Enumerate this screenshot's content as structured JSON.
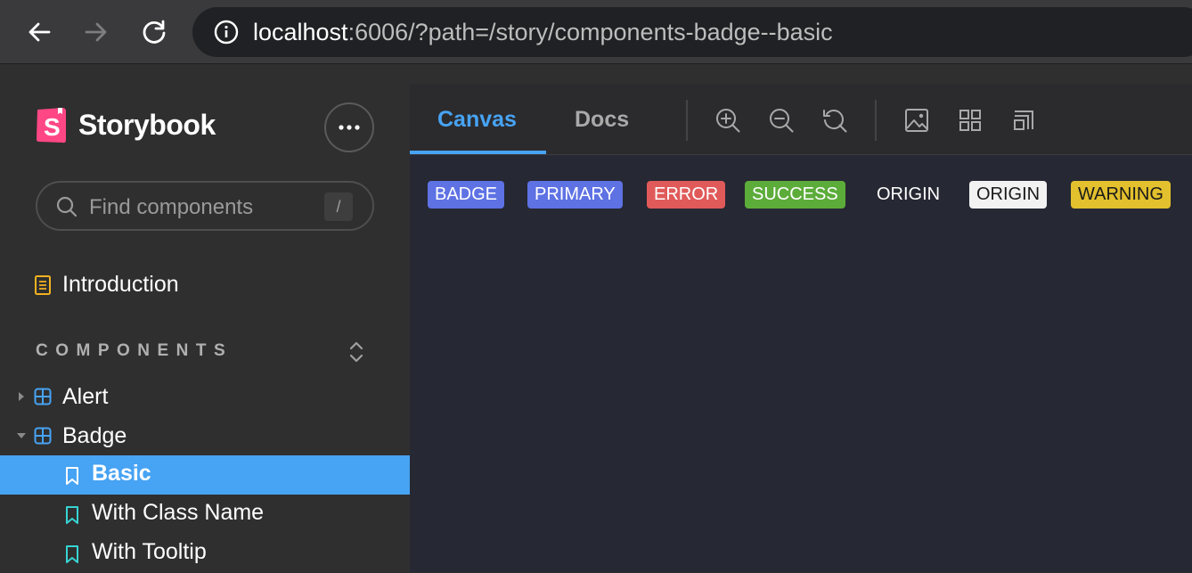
{
  "browser": {
    "url_host": "localhost",
    "url_rest": ":6006/?path=/story/components-badge--basic"
  },
  "sidebar": {
    "brand": "Storybook",
    "search_placeholder": "Find components",
    "search_shortcut": "/",
    "intro_label": "Introduction",
    "section_title": "COMPONENTS",
    "tree": [
      {
        "label": "Alert",
        "expanded": false
      },
      {
        "label": "Badge",
        "expanded": true
      }
    ],
    "stories": [
      {
        "label": "Basic",
        "active": true
      },
      {
        "label": "With Class Name",
        "active": false
      },
      {
        "label": "With Tooltip",
        "active": false
      }
    ]
  },
  "toolbar": {
    "tabs": [
      {
        "label": "Canvas",
        "active": true
      },
      {
        "label": "Docs",
        "active": false
      }
    ],
    "tools": [
      "zoom-in-icon",
      "zoom-out-icon",
      "zoom-reset-icon",
      "image-icon",
      "grid-icon",
      "outline-icon"
    ]
  },
  "canvas": {
    "badges": [
      {
        "label": "BADGE",
        "bg": "#5e72e4"
      },
      {
        "label": "PRIMARY",
        "bg": "#5e72e4"
      },
      {
        "label": "ERROR",
        "bg": "#e05a5a"
      },
      {
        "label": "SUCCESS",
        "bg": "#5cac3a"
      },
      {
        "label": "ORIGIN",
        "bg": "transparent"
      },
      {
        "label": "ORIGIN",
        "bg": "#f2f2f2"
      },
      {
        "label": "WARNING",
        "bg": "#e3c02d"
      }
    ]
  },
  "colors": {
    "accent": "#47a3f3",
    "sidebar_bg": "#2f2f2f",
    "canvas_bg": "#262833"
  }
}
